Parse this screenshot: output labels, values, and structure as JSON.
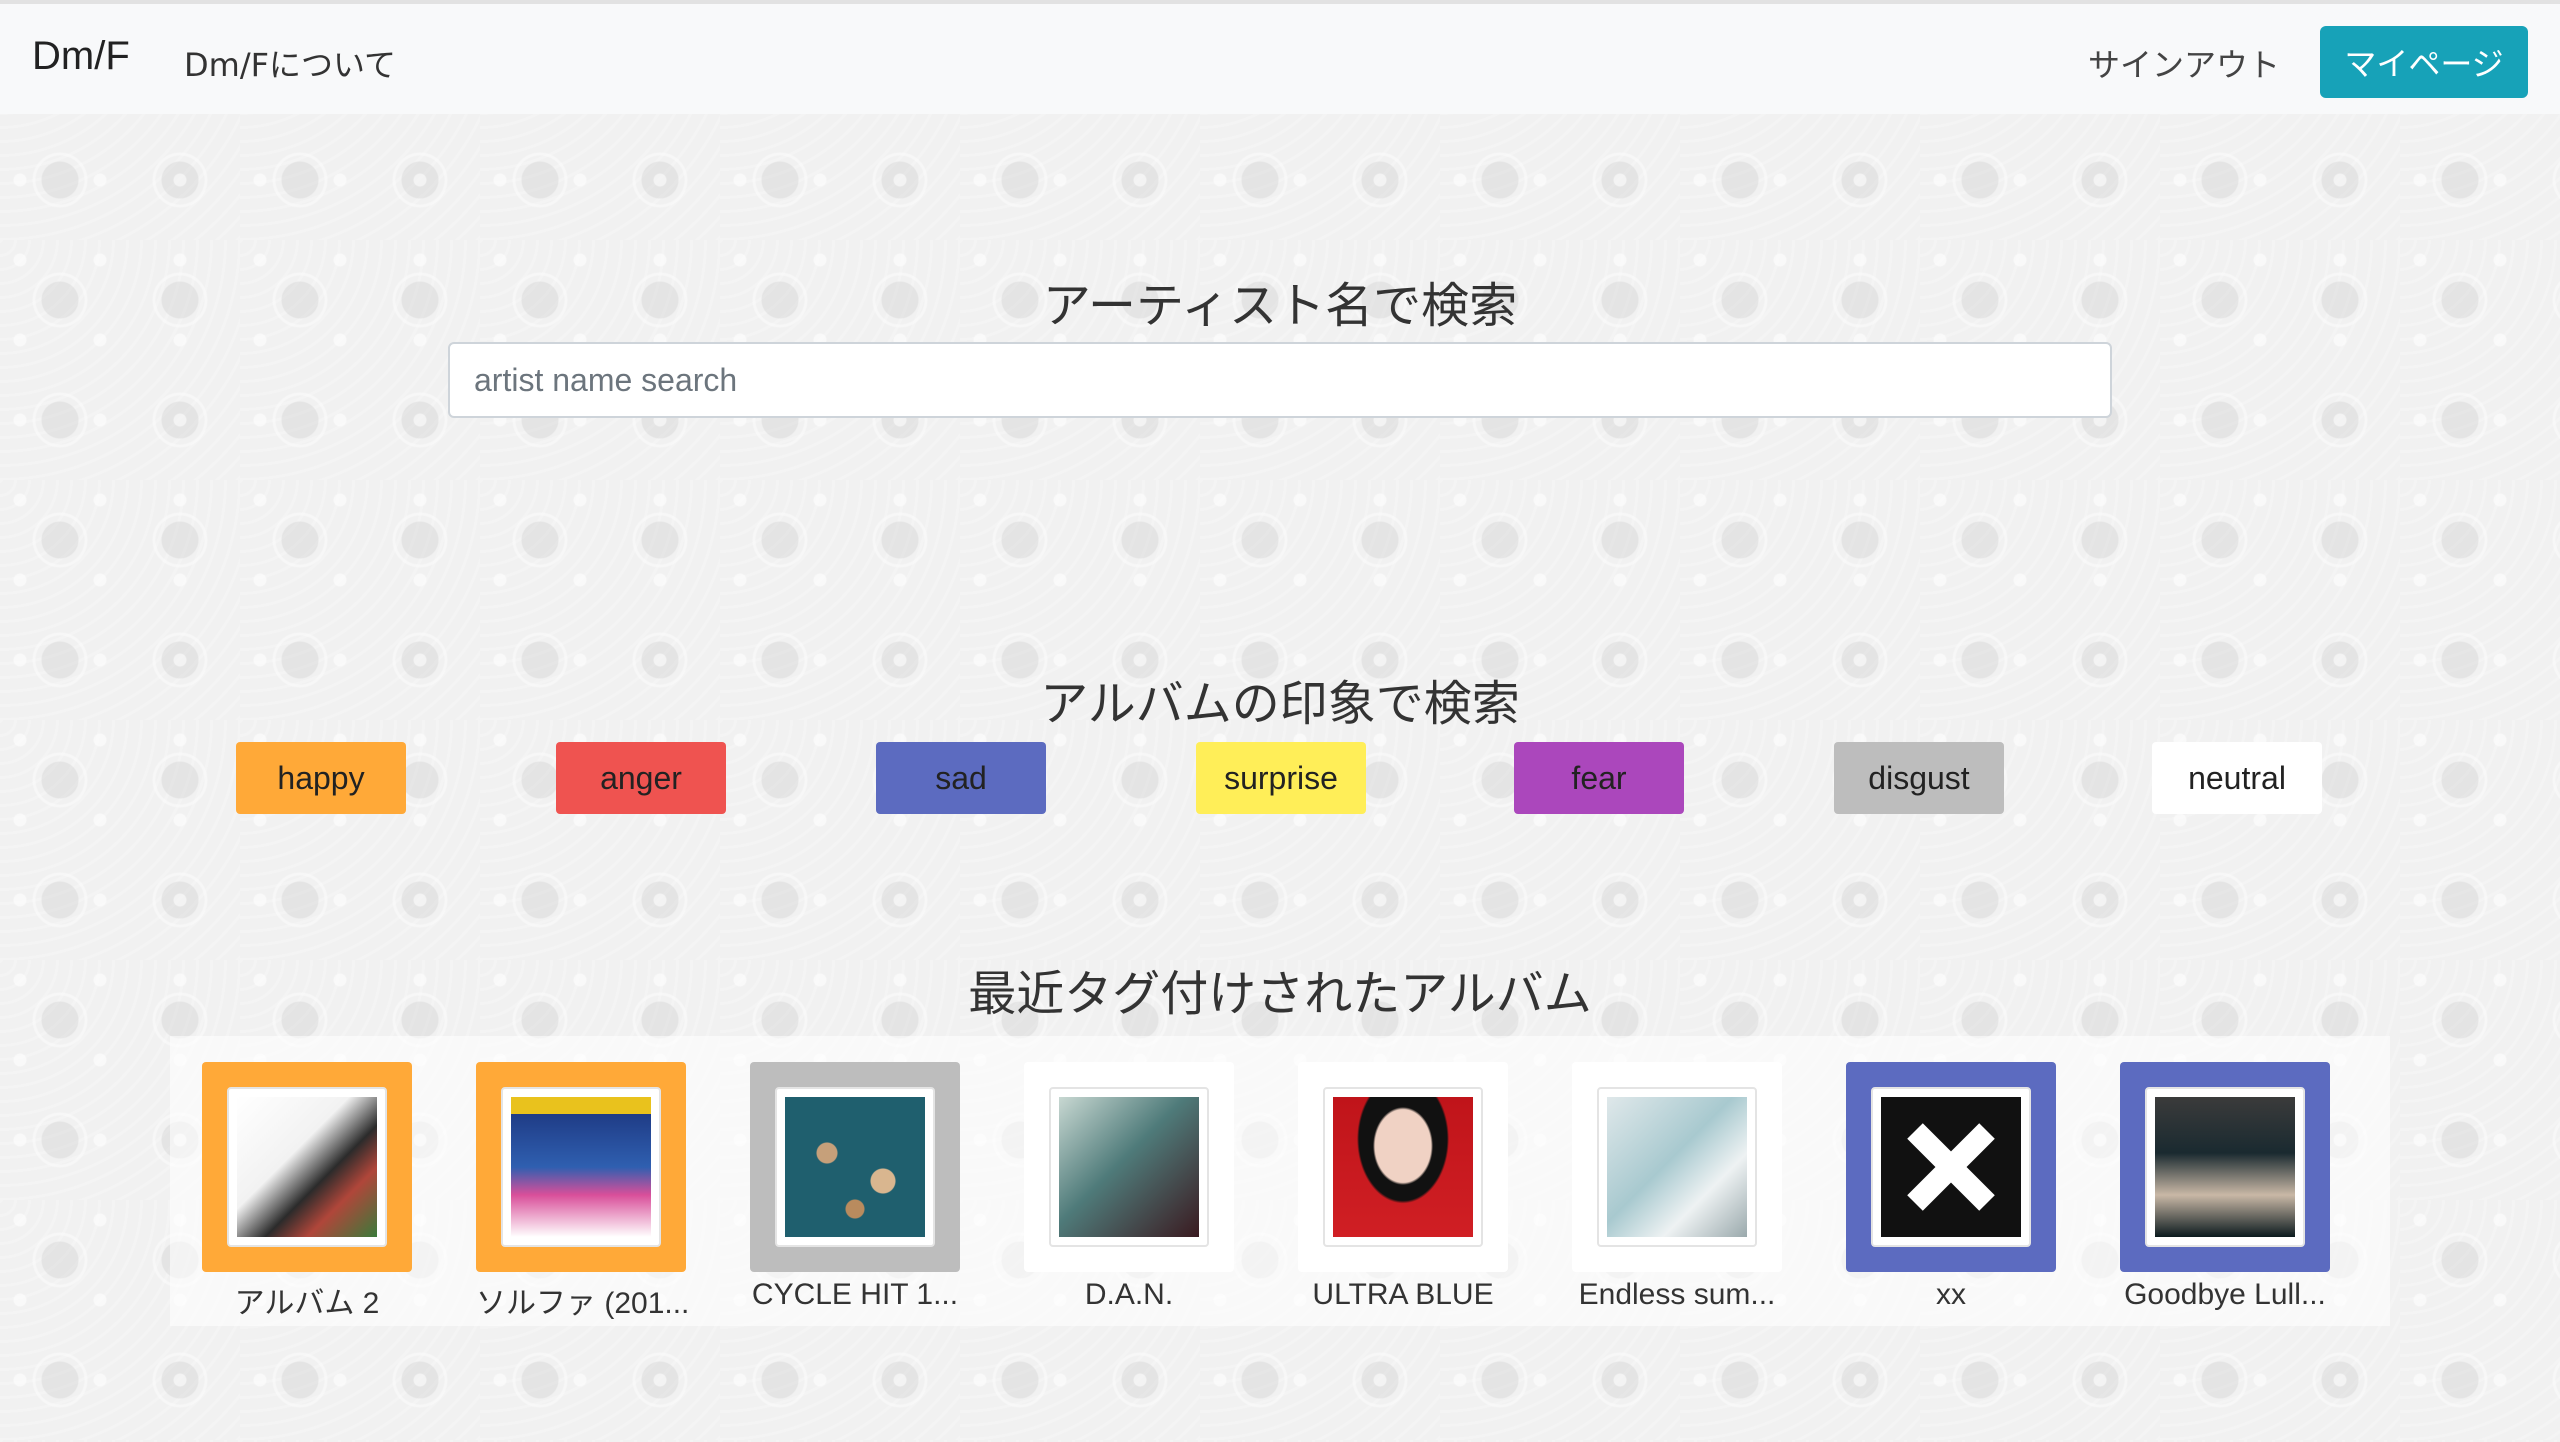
{
  "navbar": {
    "brand": "Dm/F",
    "about": "Dm/Fについて",
    "signout": "サインアウト",
    "mypage": "マイページ"
  },
  "artist_search": {
    "title": "アーティスト名で検索",
    "placeholder": "artist name search"
  },
  "emotion_search": {
    "title": "アルバムの印象で検索",
    "buttons": [
      {
        "label": "happy",
        "color": "#ffa938",
        "text_color": "#222222"
      },
      {
        "label": "anger",
        "color": "#ef5350",
        "text_color": "#222222"
      },
      {
        "label": "sad",
        "color": "#5c6bc0",
        "text_color": "#222222"
      },
      {
        "label": "surprise",
        "color": "#ffee58",
        "text_color": "#222222"
      },
      {
        "label": "fear",
        "color": "#ab47bc",
        "text_color": "#222222"
      },
      {
        "label": "disgust",
        "color": "#bdbdbd",
        "text_color": "#222222"
      },
      {
        "label": "neutral",
        "color": "#ffffff",
        "text_color": "#222222"
      }
    ]
  },
  "recent_albums": {
    "title": "最近タグ付けされたアルバム",
    "items": [
      {
        "title": "アルバム 2",
        "emotion_color": "#ffa938"
      },
      {
        "title": "ソルファ (201...",
        "emotion_color": "#ffa938"
      },
      {
        "title": "CYCLE HIT 1...",
        "emotion_color": "#bdbdbd"
      },
      {
        "title": "D.A.N.",
        "emotion_color": "#ffffff"
      },
      {
        "title": "ULTRA BLUE",
        "emotion_color": "#ffffff"
      },
      {
        "title": "Endless sum...",
        "emotion_color": "#ffffff"
      },
      {
        "title": "xx",
        "emotion_color": "#5c6bc0"
      },
      {
        "title": "Goodbye Lull...",
        "emotion_color": "#5c6bc0"
      }
    ]
  }
}
